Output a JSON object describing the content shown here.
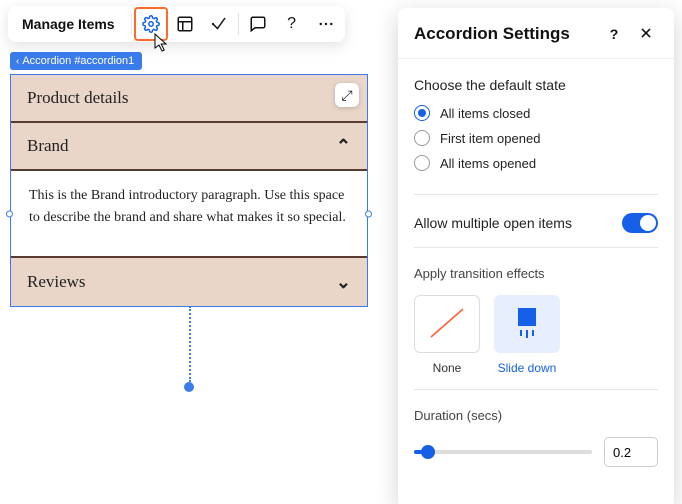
{
  "toolbar": {
    "manage_label": "Manage Items"
  },
  "breadcrumb": {
    "label": "Accordion #accordion1"
  },
  "accordion": {
    "items": [
      {
        "title": "Product details",
        "open": false,
        "body": ""
      },
      {
        "title": "Brand",
        "open": true,
        "body": "This is the Brand introductory paragraph. Use this space to describe the brand and share what makes it so special."
      },
      {
        "title": "Reviews",
        "open": false,
        "body": ""
      }
    ]
  },
  "panel": {
    "title": "Accordion Settings",
    "default_state": {
      "title": "Choose the default state",
      "options": [
        {
          "label": "All items closed",
          "checked": true
        },
        {
          "label": "First item opened",
          "checked": false
        },
        {
          "label": "All items opened",
          "checked": false
        }
      ]
    },
    "allow_multiple": {
      "label": "Allow multiple open items",
      "on": true
    },
    "transition": {
      "title": "Apply transition effects",
      "effects": [
        {
          "label": "None",
          "selected": false
        },
        {
          "label": "Slide down",
          "selected": true
        }
      ]
    },
    "duration": {
      "label": "Duration (secs)",
      "value": "0.2"
    }
  },
  "colors": {
    "accent": "#1560e6",
    "highlight": "#ff6a2b",
    "accordion_bg": "#e9d6c9",
    "accordion_rule": "#5a3b2f"
  }
}
